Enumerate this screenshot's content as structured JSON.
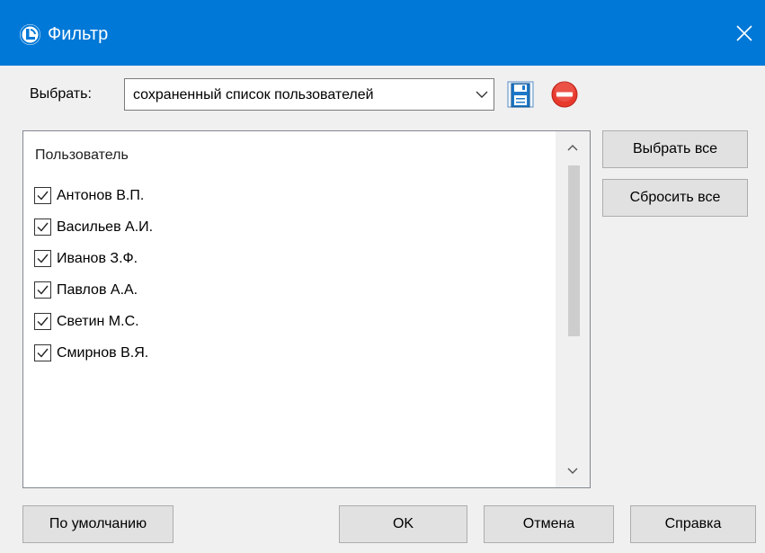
{
  "window": {
    "title": "Фильтр",
    "icon": "app-logo-icon",
    "close_icon": "close-icon"
  },
  "selector": {
    "label": "Выбрать:",
    "value": "сохраненный список пользователей",
    "save_icon": "save-list-icon",
    "delete_icon": "delete-list-icon"
  },
  "list": {
    "header": "Пользователь",
    "items": [
      {
        "label": "Антонов В.П.",
        "checked": true
      },
      {
        "label": "Васильев А.И.",
        "checked": true
      },
      {
        "label": "Иванов З.Ф.",
        "checked": true
      },
      {
        "label": "Павлов А.А.",
        "checked": true
      },
      {
        "label": "Светин М.С.",
        "checked": true
      },
      {
        "label": "Смирнов В.Я.",
        "checked": true
      }
    ]
  },
  "side_buttons": {
    "select_all": "Выбрать все",
    "reset_all": "Сбросить все"
  },
  "footer": {
    "default": "По умолчанию",
    "ok": "OK",
    "cancel": "Отмена",
    "help": "Справка"
  },
  "colors": {
    "titlebar": "#0078d7",
    "window_bg": "#f0f0f0",
    "delete_red": "#e8392d"
  }
}
